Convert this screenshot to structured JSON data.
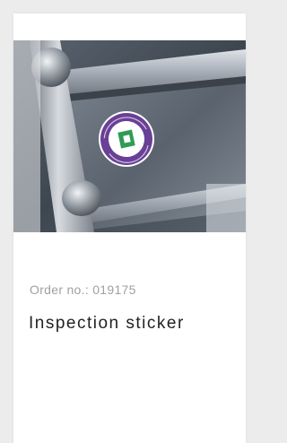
{
  "product_card": {
    "image": {
      "icon": "inspection-sticker-photo",
      "sticker_colors": {
        "ring": "#6a3f96",
        "center": "#2f9b55"
      }
    },
    "order_no": "Order no.: 019175",
    "title": "Inspection sticker"
  }
}
